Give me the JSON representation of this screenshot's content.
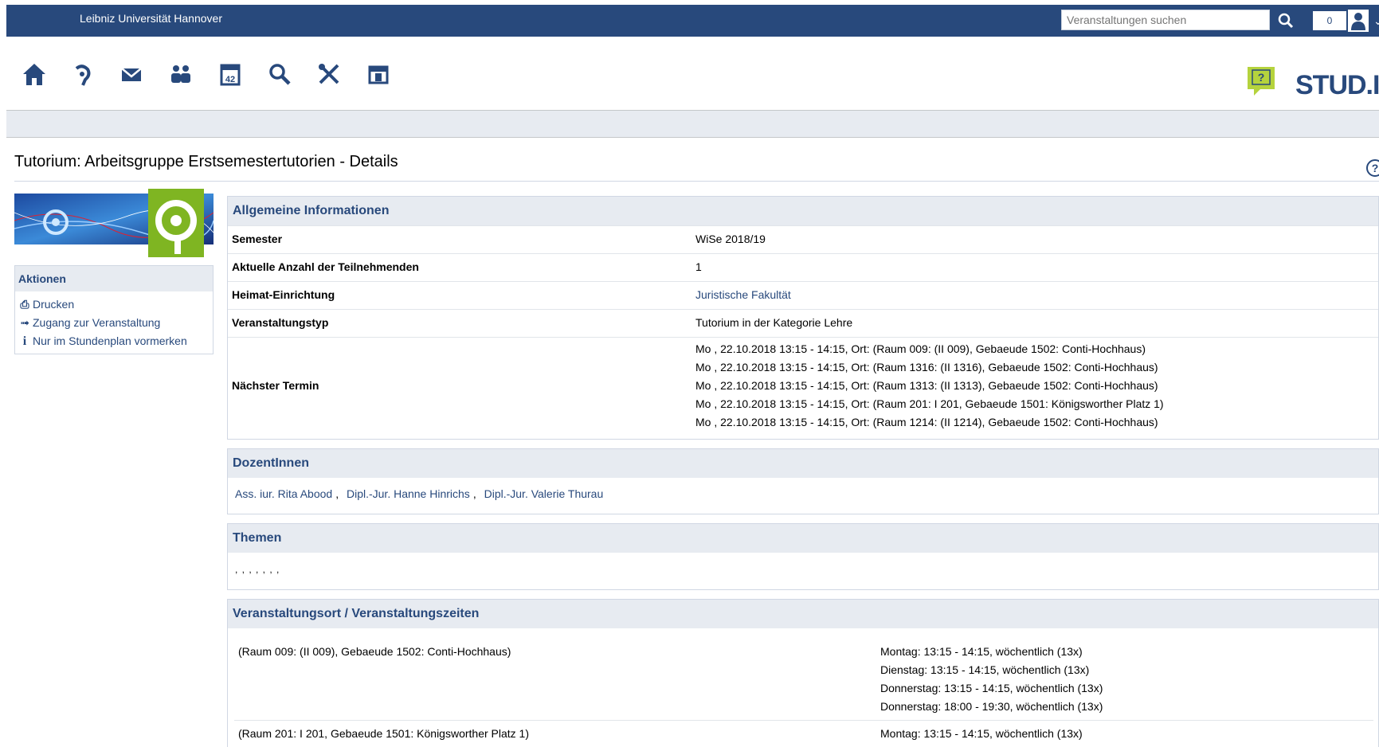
{
  "header": {
    "university": "Leibniz Universität Hannover",
    "search_placeholder": "Veranstaltungen suchen",
    "notification_count": "0"
  },
  "nav": {
    "icons": [
      "home-icon",
      "my-courses-icon",
      "messages-icon",
      "community-icon",
      "planner-icon",
      "search-icon",
      "tools-icon",
      "admin-icon"
    ]
  },
  "logo": {
    "text": "STUD.IP"
  },
  "page": {
    "title": "Tutorium: Arbeitsgruppe Erstsemestertutorien - Details"
  },
  "sidebar": {
    "title": "Aktionen",
    "actions": [
      {
        "label": "Drucken",
        "icon": "print-icon"
      },
      {
        "label": "Zugang zur Veranstaltung",
        "icon": "enter-icon"
      },
      {
        "label": "Nur im Stundenplan vormerken",
        "icon": "info-icon"
      }
    ]
  },
  "info": {
    "heading": "Allgemeine Informationen",
    "rows": [
      {
        "label": "Semester",
        "value": "WiSe 2018/19"
      },
      {
        "label": "Aktuelle Anzahl der Teilnehmenden",
        "value": "1"
      },
      {
        "label": "Heimat-Einrichtung",
        "value": "Juristische Fakultät"
      },
      {
        "label": "Veranstaltungstyp",
        "value": "Tutorium in der Kategorie Lehre"
      }
    ],
    "next_label": "Nächster Termin",
    "next_dates": [
      "Mo , 22.10.2018 13:15 - 14:15, Ort: (Raum 009: (II 009), Gebaeude 1502: Conti-Hochhaus)",
      "Mo , 22.10.2018 13:15 - 14:15, Ort: (Raum 1316: (II 1316), Gebaeude 1502: Conti-Hochhaus)",
      "Mo , 22.10.2018 13:15 - 14:15, Ort: (Raum 1313: (II 1313), Gebaeude 1502: Conti-Hochhaus)",
      "Mo , 22.10.2018 13:15 - 14:15, Ort: (Raum 201: I 201, Gebaeude 1501: Königsworther Platz 1)",
      "Mo , 22.10.2018 13:15 - 14:15, Ort: (Raum 1214: (II 1214), Gebaeude 1502: Conti-Hochhaus)"
    ]
  },
  "dozenten": {
    "heading": "DozentInnen",
    "people": [
      "Ass. iur. Rita Abood",
      "Dipl.-Jur. Hanne Hinrichs",
      "Dipl.-Jur. Valerie Thurau"
    ],
    "separator": ","
  },
  "themen": {
    "heading": "Themen",
    "content": ", , , , , , ,"
  },
  "locations": {
    "heading": "Veranstaltungsort / Veranstaltungszeiten",
    "rooms": [
      {
        "room": "(Raum 009: (II 009), Gebaeude 1502: Conti-Hochhaus)",
        "times": [
          "Montag: 13:15 - 14:15, wöchentlich (13x)",
          "Dienstag: 13:15 - 14:15, wöchentlich (13x)",
          "Donnerstag: 13:15 - 14:15, wöchentlich (13x)",
          "Donnerstag: 18:00 - 19:30, wöchentlich (13x)"
        ]
      },
      {
        "room": "(Raum 201: I 201, Gebaeude 1501: Königsworther Platz 1)",
        "times": [
          "Montag: 13:15 - 14:15, wöchentlich (13x)"
        ]
      }
    ]
  },
  "colors": {
    "brand": "#28497c",
    "panel_header": "#e7ebf1",
    "logo_green": "#7fb522"
  }
}
